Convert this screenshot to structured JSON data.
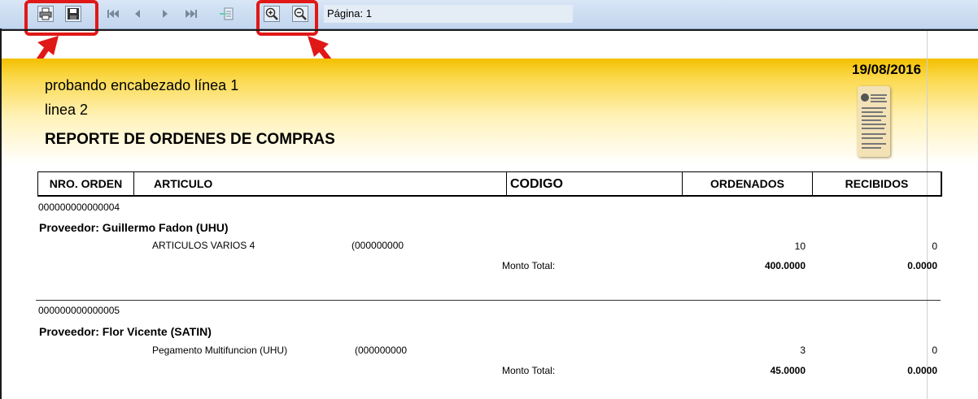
{
  "toolbar": {
    "page_label": "Página: 1",
    "buttons": [
      "print-icon",
      "save-icon",
      "first-page-icon",
      "prev-page-icon",
      "next-page-icon",
      "last-page-icon",
      "export-icon",
      "zoom-in-icon",
      "zoom-out-icon"
    ]
  },
  "colors": {
    "highlight": "#e01818",
    "header_band": "#f3bf00"
  },
  "report": {
    "header_line1": "probando encabezado línea 1",
    "header_line2": "linea 2",
    "title": "REPORTE DE ORDENES DE COMPRAS",
    "date": "19/08/2016",
    "columns": [
      "NRO. ORDEN",
      "ARTICULO",
      "CODIGO",
      "ORDENADOS",
      "RECIBIDOS"
    ],
    "orders": [
      {
        "number": "000000000000004",
        "supplier": "Proveedor: Guillermo Fadon  (UHU)",
        "article": "ARTICULOS VARIOS 4",
        "code": "(000000000",
        "ordered": "10",
        "received": "0",
        "total_label": "Monto Total:",
        "total_ordered": "400.0000",
        "total_received": "0.0000"
      },
      {
        "number": "000000000000005",
        "supplier": "Proveedor: Flor Vicente (SATIN)",
        "article": "Pegamento Multifuncion (UHU)",
        "code": "(000000000",
        "ordered": "3",
        "received": "0",
        "total_label": "Monto Total:",
        "total_ordered": "45.0000",
        "total_received": "0.0000"
      }
    ]
  }
}
